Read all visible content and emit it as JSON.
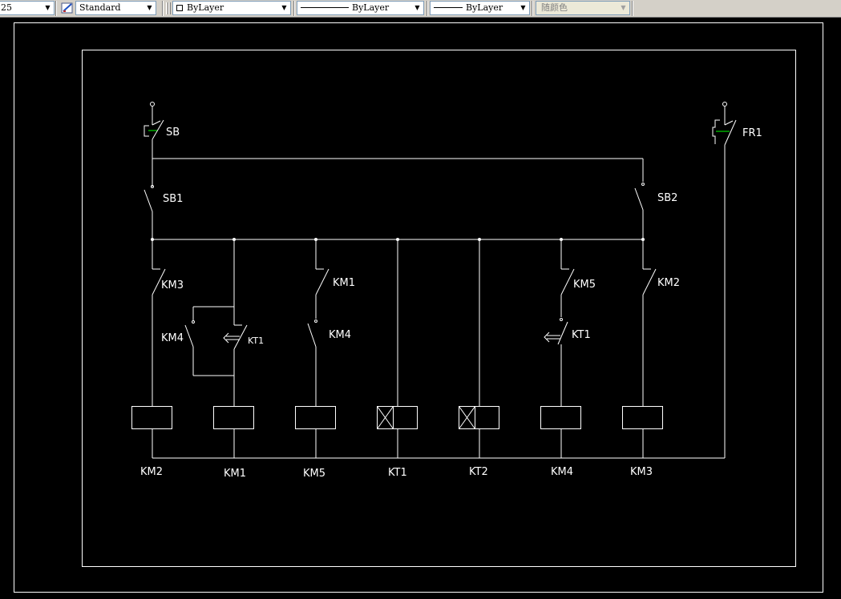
{
  "toolbar": {
    "textstyle_partial": "25",
    "dimstyle_value": "Standard",
    "layer_value": "ByLayer",
    "linetype_value": "ByLayer",
    "lineweight_value": "ByLayer",
    "plotstyle_value": "随颜色"
  },
  "drawing": {
    "labels": {
      "sb": "SB",
      "fr1": "FR1",
      "sb1": "SB1",
      "sb2": "SB2",
      "km3_contact": "KM3",
      "km1_contact": "KM1",
      "km5_contact": "KM5",
      "km2_contact": "KM2",
      "km4_contact_left": "KM4",
      "kt1_contact_left": "KT1",
      "km4_contact": "KM4",
      "kt1_contact_right": "KT1"
    },
    "coils": [
      "KM2",
      "KM1",
      "KM5",
      "KT1",
      "KT2",
      "KM4",
      "KM3"
    ],
    "colors": {
      "background": "#000000",
      "lines": "#ffffff",
      "accent": "#00ff00"
    }
  }
}
